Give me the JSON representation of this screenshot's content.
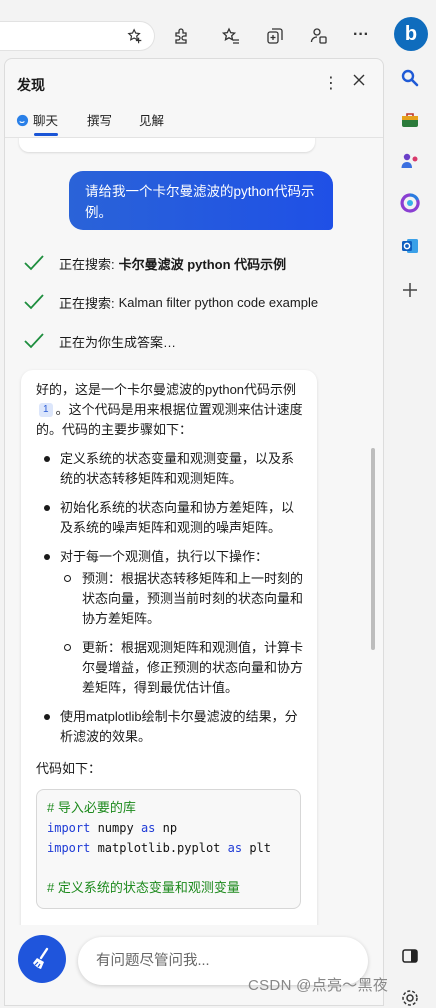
{
  "toolbar": {
    "icons": [
      "favorite-add-icon",
      "extensions-icon",
      "favorites-icon",
      "collections-icon",
      "profile-icon",
      "more-icon"
    ],
    "more_label": "···"
  },
  "sidebar_rail": {
    "bing_label": "b",
    "icons": [
      "search-icon",
      "shopping-icon",
      "games-icon",
      "microsoft365-icon",
      "outlook-icon",
      "add-icon",
      "split-screen-icon",
      "settings-icon"
    ]
  },
  "panel": {
    "title": "发现",
    "more": "⋮",
    "tabs": [
      {
        "label": "聊天",
        "active": true
      },
      {
        "label": "撰写",
        "active": false
      },
      {
        "label": "见解",
        "active": false
      }
    ]
  },
  "chat": {
    "user_message": "请给我一个卡尔曼滤波的python代码示例。",
    "statuses": [
      {
        "prefix": "正在搜索:",
        "query": "卡尔曼滤波 python 代码示例"
      },
      {
        "prefix": "正在搜索:",
        "query": "Kalman filter python code example"
      },
      {
        "prefix": "正在为你生成答案…",
        "query": ""
      }
    ],
    "answer": {
      "intro_before": "好的，这是一个卡尔曼滤波的python代码示例",
      "citation": "1",
      "intro_after": "。这个代码是用来根据位置观测来估计速度的。代码的主要步骤如下：",
      "bullets": [
        "定义系统的状态变量和观测变量，以及系统的状态转移矩阵和观测矩阵。",
        "初始化系统的状态向量和协方差矩阵，以及系统的噪声矩阵和观测的噪声矩阵。",
        "对于每一个观测值，执行以下操作：",
        "使用matplotlib绘制卡尔曼滤波的结果，分析滤波的效果。"
      ],
      "sub_bullets": [
        "预测：根据状态转移矩阵和上一时刻的状态向量，预测当前时刻的状态向量和协方差矩阵。",
        "更新：根据观测矩阵和观测值，计算卡尔曼增益，修正预测的状态向量和协方差矩阵，得到最优估计值。"
      ],
      "code_label": "代码如下：",
      "code": {
        "comment1": "# 导入必要的库",
        "line2_kw1": "import",
        "line2_mod": " numpy ",
        "line2_kw2": "as",
        "line2_alias": " np",
        "line3_kw1": "import",
        "line3_mod": " matplotlib.pyplot ",
        "line3_kw2": "as",
        "line3_alias": " plt",
        "comment2": "# 定义系统的状态变量和观测变量"
      }
    }
  },
  "input": {
    "placeholder": "有问题尽管问我..."
  },
  "watermark": "CSDN @点亮～黑夜",
  "colors": {
    "accent": "#1f55dc",
    "user_bubble": "#2a63d8",
    "check": "#1e8e3e"
  }
}
